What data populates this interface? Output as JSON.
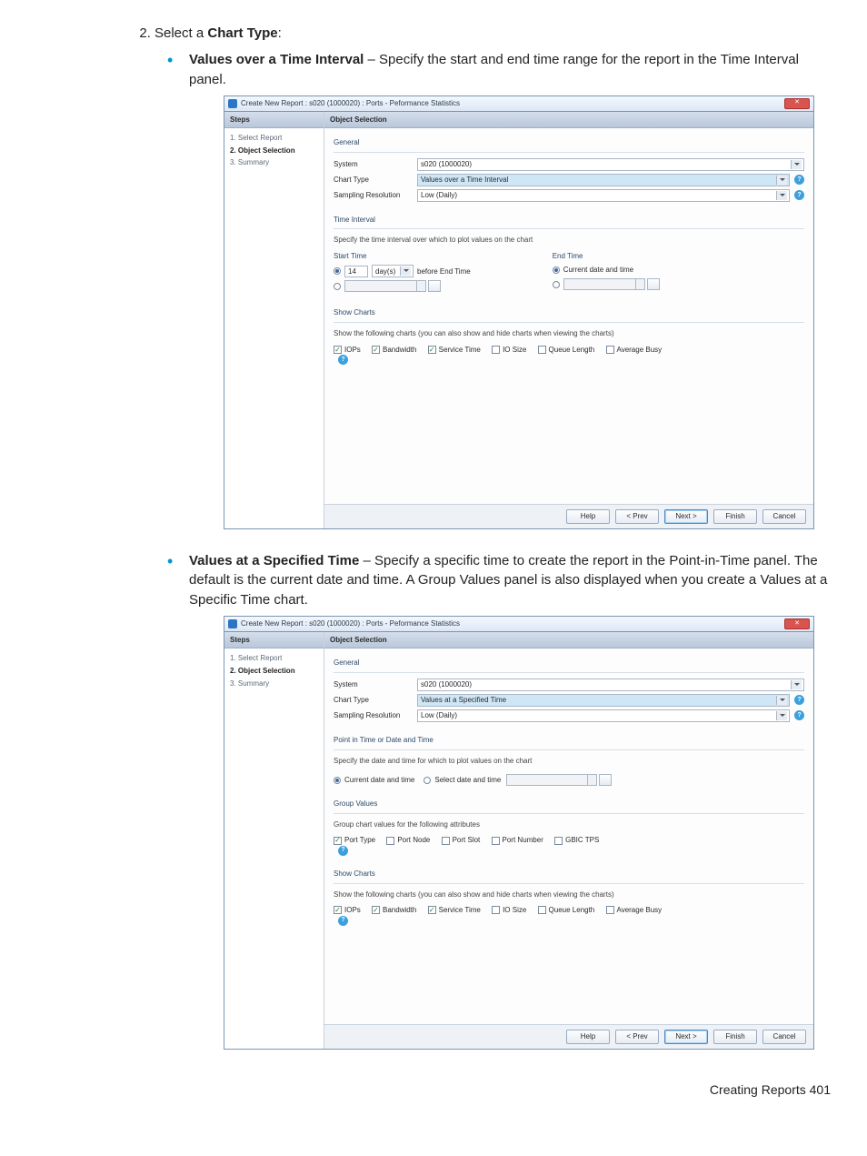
{
  "page": {
    "step_number": "2.",
    "step_text_prefix": "Select a ",
    "step_text_bold": "Chart Type",
    "step_text_suffix": ":",
    "bullet1_title": "Values over a Time Interval",
    "bullet1_rest": " – Specify the start and end time range for the report in the Time Interval panel.",
    "bullet2_title": "Values at a Specified Time",
    "bullet2_rest": " – Specify a specific time to create the report in the Point-in-Time panel. The default is the current date and time. A Group Values panel is also displayed when you create a Values at a Specific Time chart.",
    "footer": "Creating Reports   401"
  },
  "dialog1": {
    "title": "Create New Report : s020 (1000020) : Ports - Peformance Statistics",
    "steps_header": "Steps",
    "steps": [
      "1. Select Report",
      "2. Object Selection",
      "3. Summary"
    ],
    "obj_header": "Object Selection",
    "general": {
      "heading": "General",
      "system_label": "System",
      "system_value": "s020 (1000020)",
      "charttype_label": "Chart Type",
      "charttype_value": "Values over a Time Interval",
      "sampling_label": "Sampling Resolution",
      "sampling_value": "Low (Daily)"
    },
    "time_interval": {
      "heading": "Time Interval",
      "subtitle": "Specify the time interval over which to plot values on the chart",
      "start_heading": "Start Time",
      "start_value": "14",
      "start_unit": "day(s)",
      "start_suffix": "before End Time",
      "end_heading": "End Time",
      "end_now_label": "Current date and time"
    },
    "show_charts": {
      "heading": "Show Charts",
      "subtitle": "Show the following charts (you can also show and hide charts when viewing the charts)",
      "items": [
        {
          "label": "IOPs",
          "checked": true
        },
        {
          "label": "Bandwidth",
          "checked": true
        },
        {
          "label": "Service Time",
          "checked": true
        },
        {
          "label": "IO Size",
          "checked": false
        },
        {
          "label": "Queue Length",
          "checked": false
        },
        {
          "label": "Average Busy",
          "checked": false
        }
      ]
    },
    "buttons": {
      "help": "Help",
      "prev": "< Prev",
      "next": "Next >",
      "finish": "Finish",
      "cancel": "Cancel"
    }
  },
  "dialog2": {
    "title": "Create New Report : s020 (1000020) : Ports - Peformance Statistics",
    "steps_header": "Steps",
    "steps": [
      "1. Select Report",
      "2. Object Selection",
      "3. Summary"
    ],
    "obj_header": "Object Selection",
    "general": {
      "heading": "General",
      "system_label": "System",
      "system_value": "s020 (1000020)",
      "charttype_label": "Chart Type",
      "charttype_value": "Values at a Specified Time",
      "sampling_label": "Sampling Resolution",
      "sampling_value": "Low (Daily)"
    },
    "pit": {
      "heading": "Point in Time or Date and Time",
      "subtitle": "Specify the date and time for which to plot values on the chart",
      "now_label": "Current date and time",
      "sel_label": "Select date and time"
    },
    "group_values": {
      "heading": "Group Values",
      "subtitle": "Group chart values for the following attributes",
      "items": [
        {
          "label": "Port Type",
          "checked": true
        },
        {
          "label": "Port Node",
          "checked": false
        },
        {
          "label": "Port Slot",
          "checked": false
        },
        {
          "label": "Port Number",
          "checked": false
        },
        {
          "label": "GBIC TPS",
          "checked": false
        }
      ]
    },
    "show_charts": {
      "heading": "Show Charts",
      "subtitle": "Show the following charts (you can also show and hide charts when viewing the charts)",
      "items": [
        {
          "label": "IOPs",
          "checked": true
        },
        {
          "label": "Bandwidth",
          "checked": true
        },
        {
          "label": "Service Time",
          "checked": true
        },
        {
          "label": "IO Size",
          "checked": false
        },
        {
          "label": "Queue Length",
          "checked": false
        },
        {
          "label": "Average Busy",
          "checked": false
        }
      ]
    },
    "buttons": {
      "help": "Help",
      "prev": "< Prev",
      "next": "Next >",
      "finish": "Finish",
      "cancel": "Cancel"
    }
  }
}
